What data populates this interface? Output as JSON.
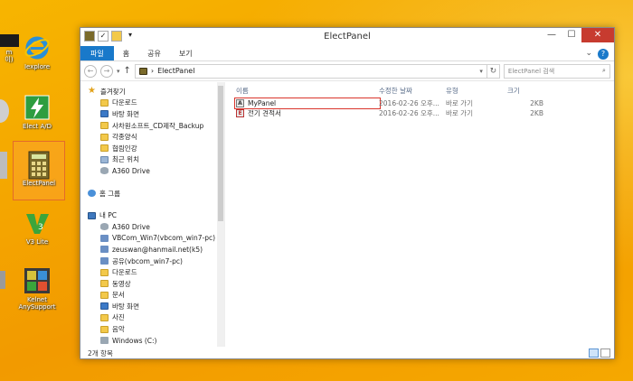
{
  "desktop": {
    "icons": [
      {
        "label": "m\n이)",
        "name": "desktop-icon-partial-top"
      },
      {
        "label": "Iexplore",
        "name": "desktop-icon-iexplore"
      },
      {
        "label": "Elect A/D",
        "name": "desktop-icon-elect-ad"
      },
      {
        "label": "ElectPanel",
        "name": "desktop-icon-electpanel"
      },
      {
        "label": "V3 Lite",
        "name": "desktop-icon-v3-lite"
      },
      {
        "label": "Kelnet\nAnySupport",
        "name": "desktop-icon-kelnet"
      }
    ]
  },
  "window": {
    "title": "ElectPanel",
    "controls": {
      "minimize": "—",
      "maximize": "☐",
      "close": "✕"
    },
    "ribbon_tabs": [
      "파일",
      "홈",
      "공유",
      "보기"
    ],
    "address": {
      "path_sep": "›",
      "path": "ElectPanel"
    },
    "search_placeholder": "ElectPanel 검색",
    "nav": {
      "favorites_header": "즐겨찾기",
      "favorites": [
        "다운로드",
        "바탕 화면",
        "사차원소프트_CD제작_Backup",
        "각종양식",
        "협림인강",
        "최근 위치",
        "A360 Drive"
      ],
      "homegroup": "홈 그룹",
      "pc_header": "내 PC",
      "pc_items": [
        "A360 Drive",
        "VBCom_Win7(vbcom_win7-pc)",
        "zeuswan@hanmail.net(k5)",
        "공유(vbcom_win7-pc)",
        "다운로드",
        "동영상",
        "문서",
        "바탕 화면",
        "사진",
        "음악",
        "Windows (C:)"
      ]
    },
    "columns": [
      "이름",
      "수정한 날짜",
      "유형",
      "크기"
    ],
    "files": [
      {
        "name": "MyPanel",
        "date": "2016-02-26 오후...",
        "type": "바로 가기",
        "size": "2KB"
      },
      {
        "name": "전기 견적서",
        "date": "2016-02-26 오후...",
        "type": "바로 가기",
        "size": "2KB"
      }
    ],
    "status": "2개 항목"
  }
}
